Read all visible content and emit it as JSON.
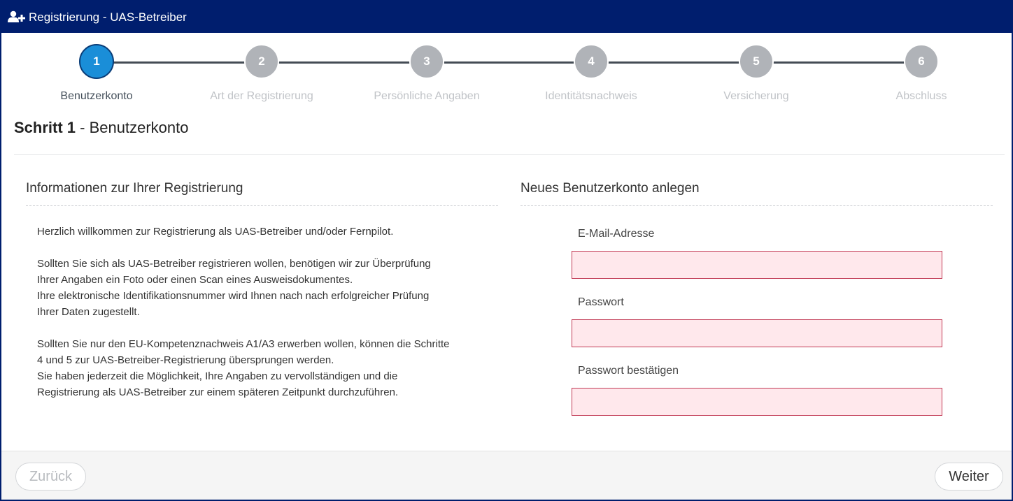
{
  "window": {
    "title": "Registrierung - UAS-Betreiber",
    "icon": "user-add-icon"
  },
  "stepper": {
    "active_index": 0,
    "steps": [
      {
        "number": "1",
        "label": "Benutzerkonto"
      },
      {
        "number": "2",
        "label": "Art der Registrierung"
      },
      {
        "number": "3",
        "label": "Persönliche Angaben"
      },
      {
        "number": "4",
        "label": "Identitätsnachweis"
      },
      {
        "number": "5",
        "label": "Versicherung"
      },
      {
        "number": "6",
        "label": "Abschluss"
      }
    ]
  },
  "page": {
    "step_prefix": "Schritt 1",
    "step_title": "- Benutzerkonto"
  },
  "info": {
    "title": "Informationen zur Ihrer Registrierung",
    "paragraphs": [
      [
        "Herzlich willkommen zur Registrierung als UAS-Betreiber und/oder Fernpilot."
      ],
      [
        "Sollten Sie sich als UAS-Betreiber registrieren wollen, benötigen wir zur Überprüfung",
        "Ihrer Angaben ein Foto oder einen Scan eines Ausweisdokumentes.",
        "Ihre elektronische Identifikationsnummer wird Ihnen nach nach erfolgreicher Prüfung",
        "Ihrer Daten zugestellt."
      ],
      [
        "Sollten Sie nur den EU-Kompetenznachweis A1/A3 erwerben wollen, können die Schritte",
        "4 und 5 zur UAS-Betreiber-Registrierung übersprungen werden.",
        "Sie haben jederzeit die Möglichkeit, Ihre Angaben zu vervollständigen und die",
        "Registrierung als UAS-Betreiber zur einem späteren Zeitpunkt durchzuführen."
      ]
    ]
  },
  "account": {
    "title": "Neues Benutzerkonto anlegen",
    "email_label": "E-Mail-Adresse",
    "email_value": "",
    "password_label": "Passwort",
    "password_value": "",
    "confirm_label": "Passwort bestätigen",
    "confirm_value": ""
  },
  "footer": {
    "back_label": "Zurück",
    "next_label": "Weiter"
  },
  "colors": {
    "titlebar": "#001e6e",
    "active_step": "#1a8ed8",
    "inactive_step": "#b0b3b8",
    "invalid_field_bg": "#ffe8ec",
    "invalid_field_border": "#c23a55"
  }
}
